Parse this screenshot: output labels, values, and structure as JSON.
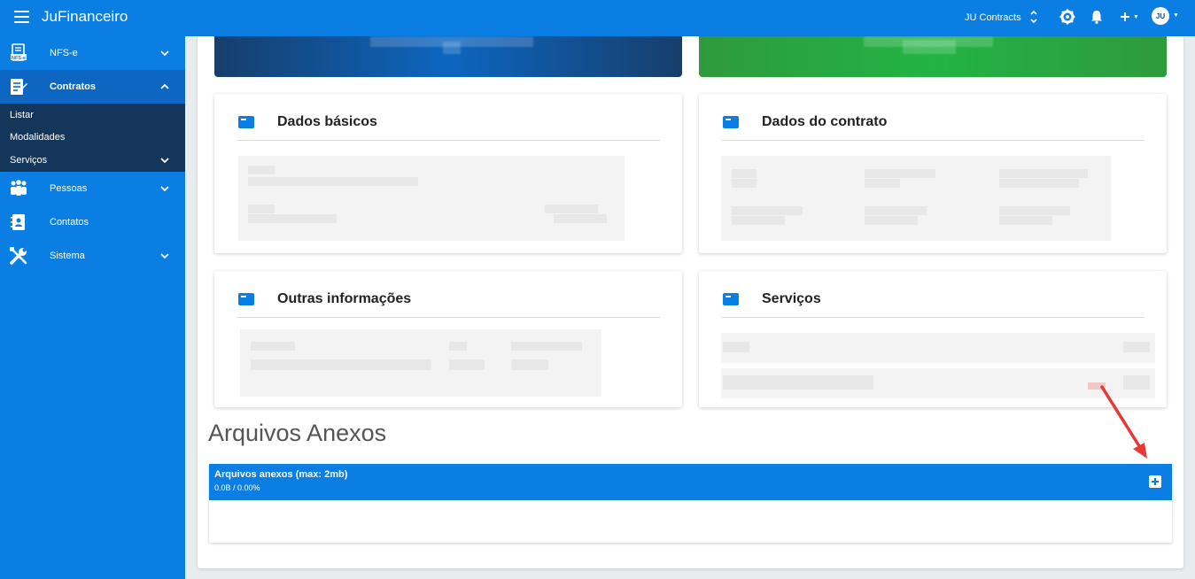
{
  "app": {
    "title": "JuFinanceiro"
  },
  "topbar": {
    "org_name": "JU Contracts",
    "avatar_initials": "JU",
    "icons": [
      "menu-icon",
      "settings-icon",
      "bell-icon",
      "plus-icon"
    ]
  },
  "sidebar": {
    "items": [
      {
        "label": "NFS-e",
        "icon": "nfse-icon",
        "expanded": false
      },
      {
        "label": "Contratos",
        "icon": "contract-icon",
        "expanded": true,
        "children": [
          {
            "label": "Listar"
          },
          {
            "label": "Modalidades"
          },
          {
            "label": "Serviços"
          }
        ]
      },
      {
        "label": "Pessoas",
        "icon": "people-icon",
        "expanded": false
      },
      {
        "label": "Contatos",
        "icon": "contacts-icon",
        "expanded": false
      },
      {
        "label": "Sistema",
        "icon": "tools-icon",
        "expanded": false
      }
    ]
  },
  "cards": {
    "dados_basicos": {
      "title": "Dados básicos"
    },
    "dados_contrato": {
      "title": "Dados do contrato"
    },
    "outras_informacoes": {
      "title": "Outras informações"
    },
    "servicos": {
      "title": "Serviços"
    }
  },
  "attachments": {
    "section_title": "Arquivos Anexos",
    "panel_title": "Arquivos anexos (max: 2mb)",
    "usage": "0.0B / 0.00%"
  },
  "colors": {
    "primary": "#0a7ee3",
    "sidebar_submenu": "#14365a",
    "banner_blue": "#0c66c0",
    "banner_green": "#22b344",
    "annotation_arrow": "#e53935"
  }
}
